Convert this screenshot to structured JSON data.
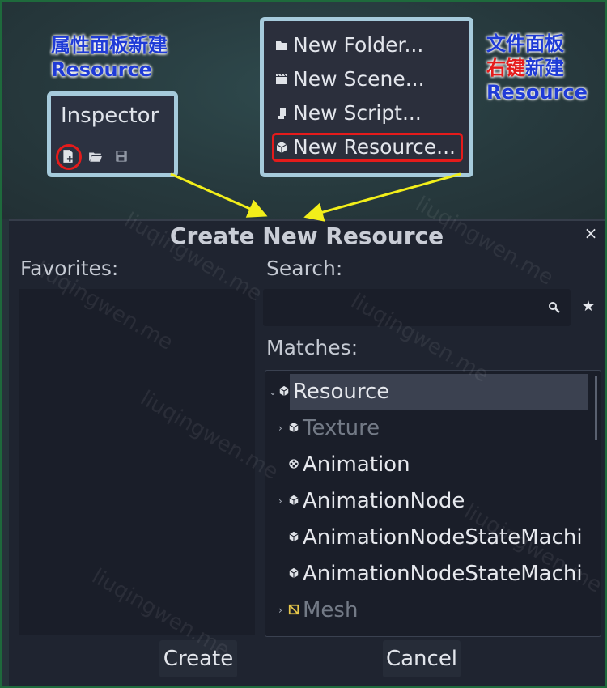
{
  "annotations": {
    "inspector_caption_line1": "属性面板新建",
    "inspector_caption_line2": "Resource",
    "filesystem_caption_line1": "文件面板",
    "filesystem_caption_line2_red": "右键",
    "filesystem_caption_line2_blue": "新建",
    "filesystem_caption_line3": "Resource"
  },
  "inspector": {
    "title": "Inspector",
    "icons": [
      "new-resource-icon",
      "folder-open-icon",
      "save-icon"
    ]
  },
  "context_menu": {
    "items": [
      {
        "label": "New Folder...",
        "icon": "folder-icon"
      },
      {
        "label": "New Scene...",
        "icon": "clapperboard-icon"
      },
      {
        "label": "New Script...",
        "icon": "script-icon"
      },
      {
        "label": "New Resource...",
        "icon": "resource-cube-icon",
        "highlighted": true
      }
    ]
  },
  "dialog": {
    "title": "Create New Resource",
    "favorites_label": "Favorites:",
    "search_label": "Search:",
    "search_value": "",
    "matches_label": "Matches:",
    "tree": [
      {
        "label": "Resource",
        "arrow": "down",
        "icon": "resource-cube-icon",
        "selected": true,
        "dim": false,
        "level": 0
      },
      {
        "label": "Texture",
        "arrow": "right",
        "icon": "resource-cube-icon",
        "selected": false,
        "dim": true,
        "level": 1
      },
      {
        "label": "Animation",
        "arrow": "",
        "icon": "animation-icon",
        "selected": false,
        "dim": false,
        "level": 1
      },
      {
        "label": "AnimationNode",
        "arrow": "right",
        "icon": "resource-cube-icon",
        "selected": false,
        "dim": false,
        "level": 1
      },
      {
        "label": "AnimationNodeStateMachi",
        "arrow": "",
        "icon": "resource-cube-icon",
        "selected": false,
        "dim": false,
        "level": 1
      },
      {
        "label": "AnimationNodeStateMachi",
        "arrow": "",
        "icon": "resource-cube-icon",
        "selected": false,
        "dim": false,
        "level": 1
      },
      {
        "label": "Mesh",
        "arrow": "right",
        "icon": "mesh-icon",
        "selected": false,
        "dim": true,
        "level": 1
      }
    ],
    "create_button": "Create",
    "cancel_button": "Cancel",
    "close_symbol": "×",
    "favorite_symbol": "★"
  },
  "watermark_text": "liuqingwen.me",
  "colors": {
    "highlight_red": "#e51b1b",
    "caption_blue": "#1f3bd6",
    "arrow_yellow": "#f2ee1a",
    "panel_border": "#a6cbdc"
  }
}
